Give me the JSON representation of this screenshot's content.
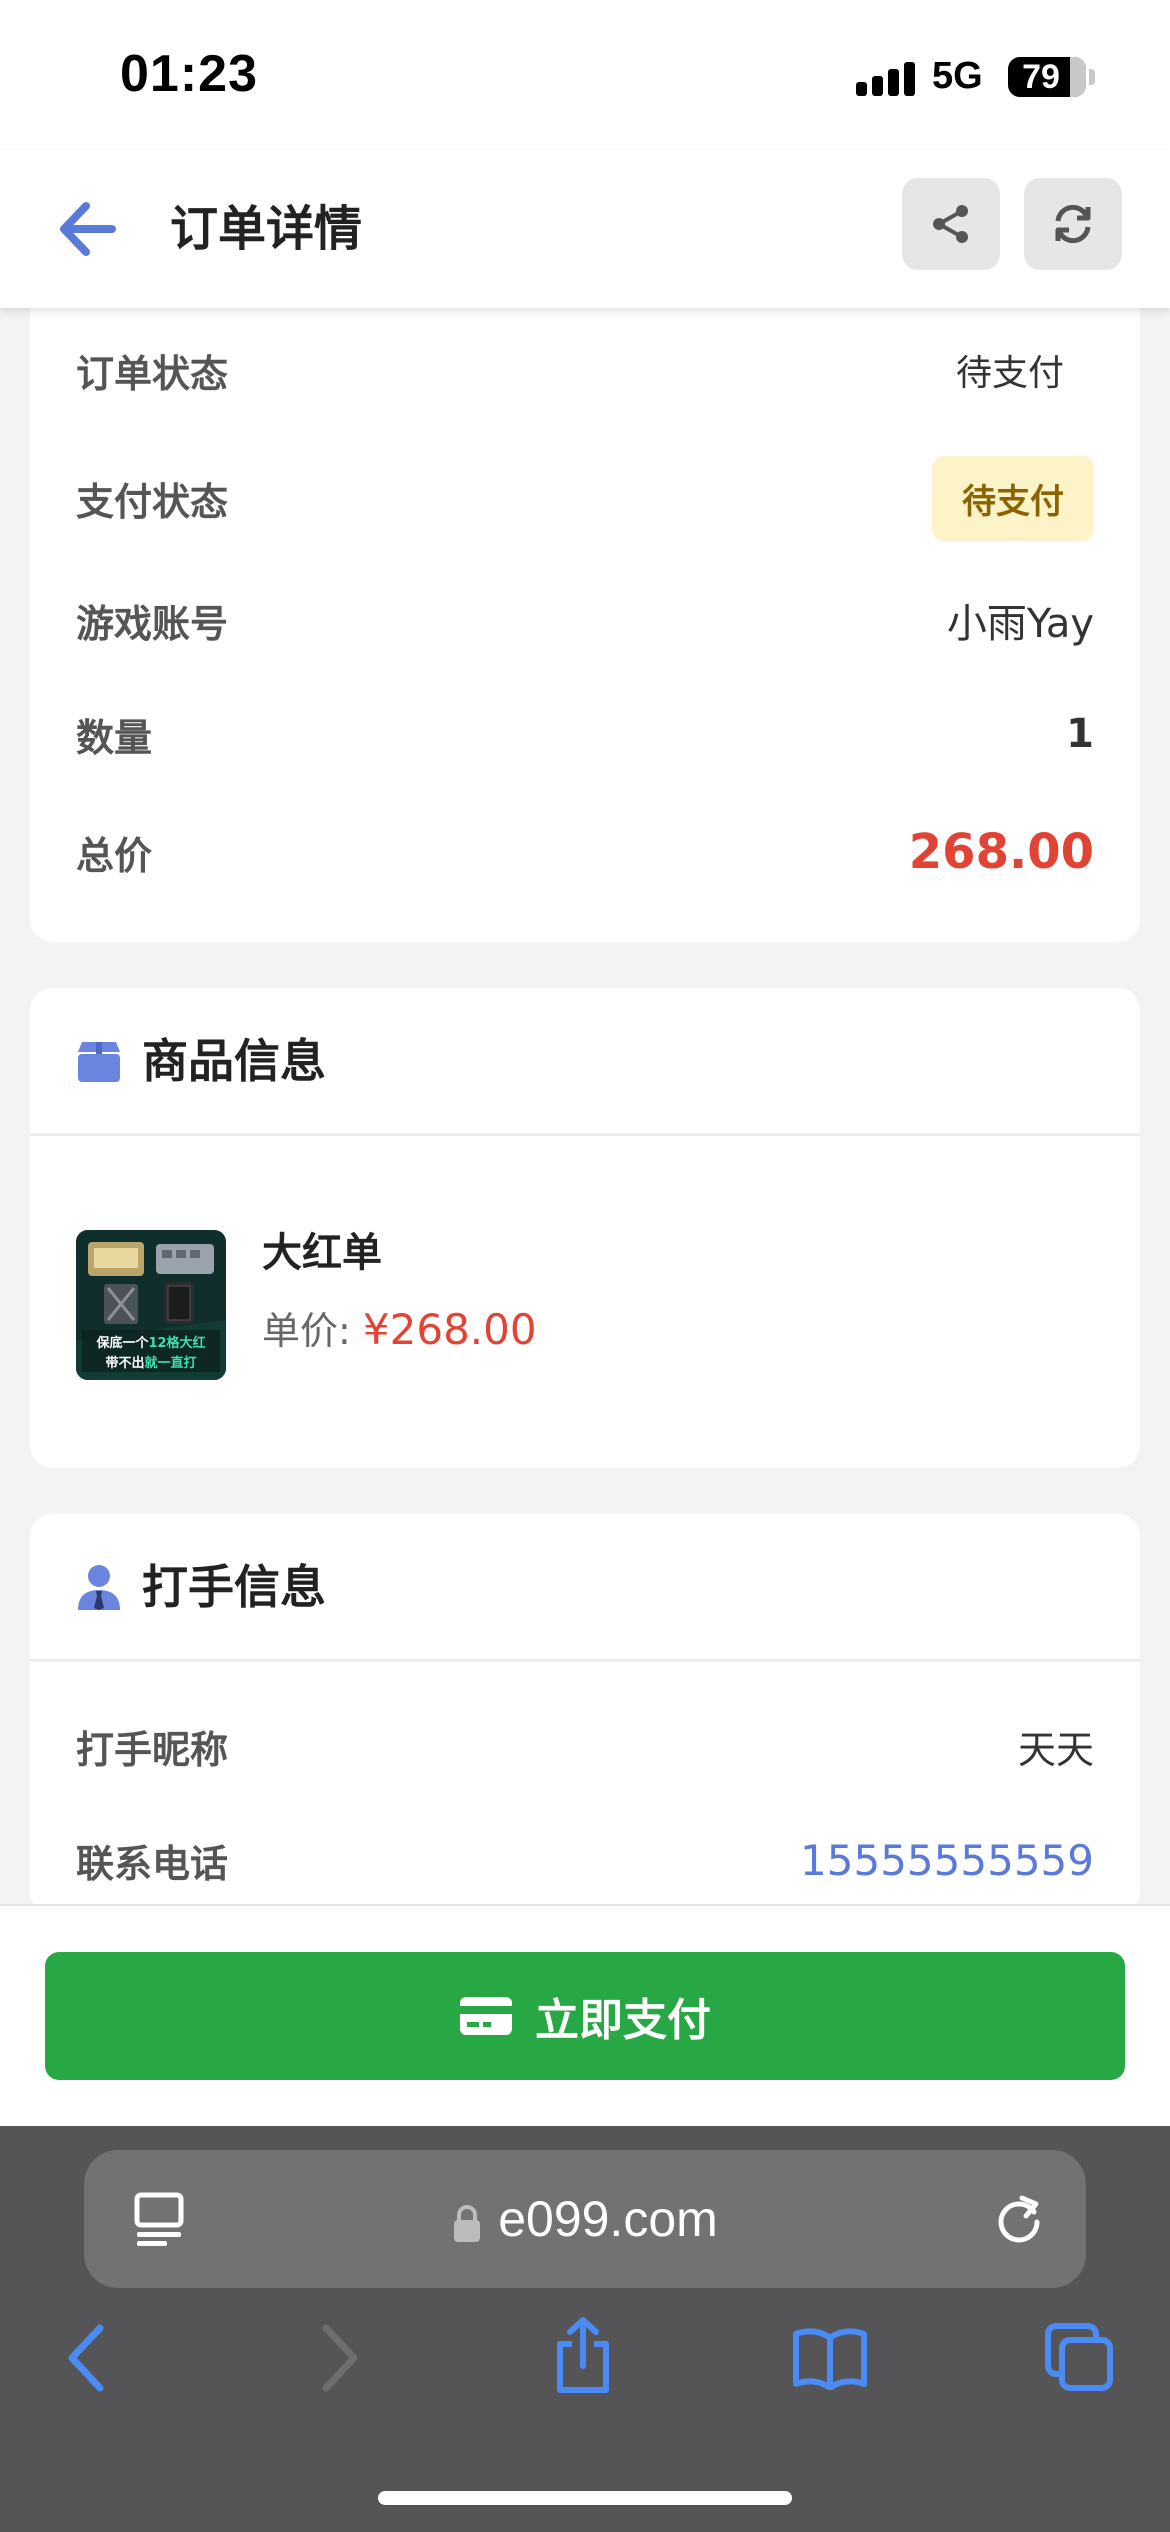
{
  "status_bar": {
    "time": "01:23",
    "network": "5G",
    "battery": "79"
  },
  "header": {
    "title": "订单详情",
    "icons": {
      "back": "arrow-left-icon",
      "share": "share-icon",
      "refresh": "refresh-icon"
    }
  },
  "order": {
    "rows": [
      {
        "label": "订单状态",
        "value": "待支付"
      },
      {
        "label": "支付状态",
        "value": "待支付"
      },
      {
        "label": "游戏账号",
        "value": "小雨Yay"
      },
      {
        "label": "数量",
        "value": "1"
      },
      {
        "label": "总价",
        "value": "268.00"
      }
    ]
  },
  "product_section": {
    "title": "商品信息",
    "icon": "box-icon",
    "name": "大红单",
    "price_label": "单价:",
    "price_value": "¥268.00",
    "thumbnail_text": [
      "保底一个",
      "12格大红",
      "带不出",
      "就一直打"
    ]
  },
  "booster_section": {
    "title": "打手信息",
    "icon": "user-tie-icon",
    "rows": [
      {
        "label": "打手昵称",
        "value": "天天"
      },
      {
        "label": "联系电话",
        "value": "15555555559"
      }
    ]
  },
  "pay": {
    "label": "立即支付",
    "icon": "credit-card-icon"
  },
  "browser": {
    "url": "e099.com",
    "icons": [
      "reader-icon",
      "lock-icon",
      "reload-icon",
      "back-icon",
      "forward-icon",
      "share-icon",
      "bookmarks-icon",
      "tabs-icon"
    ]
  },
  "colors": {
    "accent_blue": "#5b7ad8",
    "price_red": "#e04434",
    "pay_green": "#28a745",
    "badge_bg": "#fdf3c8",
    "badge_text": "#8a6400"
  }
}
